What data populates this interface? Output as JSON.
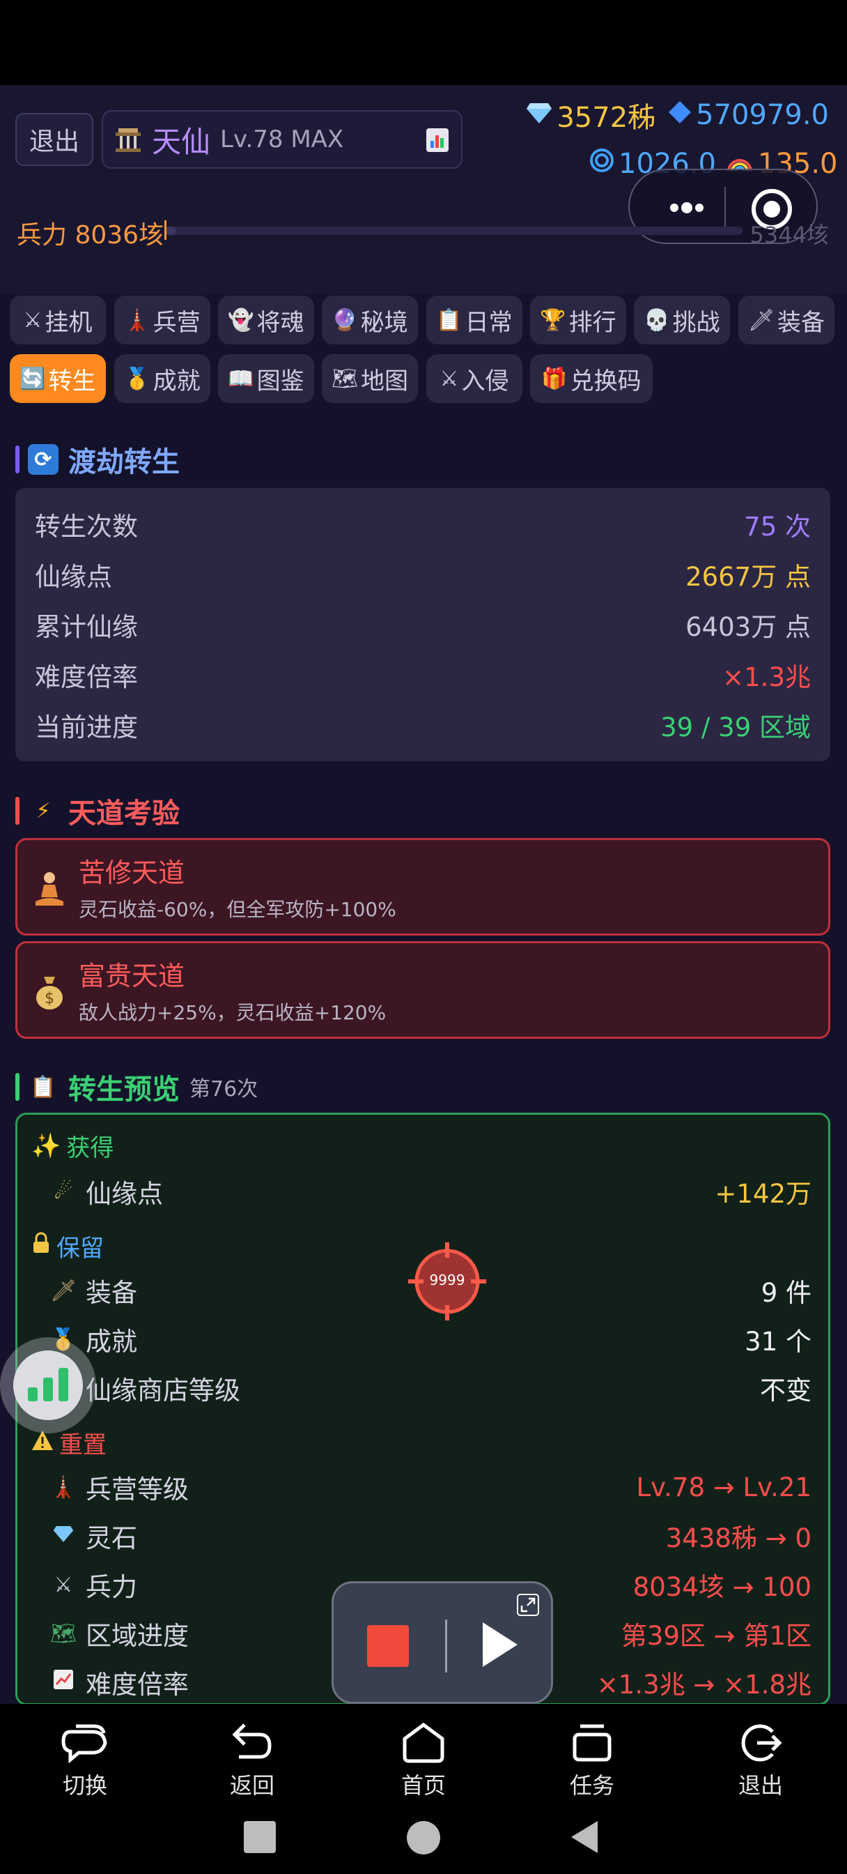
{
  "header": {
    "exit_label": "退出",
    "title_name": "天仙",
    "title_level": "Lv.78 MAX",
    "diamond_value": "3572秭",
    "crystal_value": "570979.0",
    "swirl_value": "1026.0",
    "rainbow_value": "135.0",
    "power_label": "兵力 8036垓",
    "power_right": "5344垓",
    "power_fraction": 0.02
  },
  "tabs": {
    "row1": [
      {
        "icon": "⚔",
        "label": "挂机"
      },
      {
        "icon": "🗼",
        "label": "兵营"
      },
      {
        "icon": "👻",
        "label": "将魂"
      },
      {
        "icon": "🔮",
        "label": "秘境"
      },
      {
        "icon": "📋",
        "label": "日常"
      },
      {
        "icon": "🏆",
        "label": "排行"
      },
      {
        "icon": "💀",
        "label": "挑战"
      },
      {
        "icon": "🗡",
        "label": "装备"
      }
    ],
    "row2": [
      {
        "icon": "🔄",
        "label": "转生"
      },
      {
        "icon": "🥇",
        "label": "成就"
      },
      {
        "icon": "📖",
        "label": "图鉴"
      },
      {
        "icon": "🗺",
        "label": "地图"
      },
      {
        "icon": "⚔",
        "label": "入侵"
      },
      {
        "icon": "🎁",
        "label": "兑换码"
      }
    ]
  },
  "rebirth": {
    "title": "渡劫转生",
    "rows": [
      {
        "label": "转生次数",
        "value": "75 次"
      },
      {
        "label": "仙缘点",
        "value": "2667万 点"
      },
      {
        "label": "累计仙缘",
        "value": "6403万 点"
      },
      {
        "label": "难度倍率",
        "value": "×1.3兆"
      },
      {
        "label": "当前进度",
        "value": "39 / 39 区域"
      }
    ]
  },
  "trials": {
    "title": "天道考验",
    "items": [
      {
        "name": "苦修天道",
        "desc": "灵石收益-60%，但全军攻防+100%"
      },
      {
        "name": "富贵天道",
        "desc": "敌人战力+25%，灵石收益+120%"
      }
    ]
  },
  "preview": {
    "title": "转生预览",
    "count": "第76次",
    "gain_label": "获得",
    "gain_rows": [
      {
        "label": "仙缘点",
        "value": "+142万"
      }
    ],
    "keep_label": "保留",
    "keep_rows": [
      {
        "label": "装备",
        "value": "9 件"
      },
      {
        "label": "成就",
        "value": "31 个"
      },
      {
        "label": "仙缘商店等级",
        "value": "不变"
      }
    ],
    "reset_label": "重置",
    "reset_rows": [
      {
        "label": "兵营等级",
        "value": "Lv.78 → Lv.21"
      },
      {
        "label": "灵石",
        "value": "3438秭 → 0"
      },
      {
        "label": "兵力",
        "value": "8034垓 → 100"
      },
      {
        "label": "区域进度",
        "value": "第39区 → 第1区"
      },
      {
        "label": "难度倍率",
        "value": "×1.3兆 → ×1.8兆"
      }
    ]
  },
  "crosshair_text": "9999",
  "bottom_nav": [
    {
      "label": "切换"
    },
    {
      "label": "返回"
    },
    {
      "label": "首页"
    },
    {
      "label": "任务"
    },
    {
      "label": "退出"
    }
  ],
  "colors": {
    "accent_orange": "#ff8a1f",
    "trial_red": "#ff5c5c",
    "preview_green": "#2e9e56",
    "gold": "#f5c542"
  }
}
